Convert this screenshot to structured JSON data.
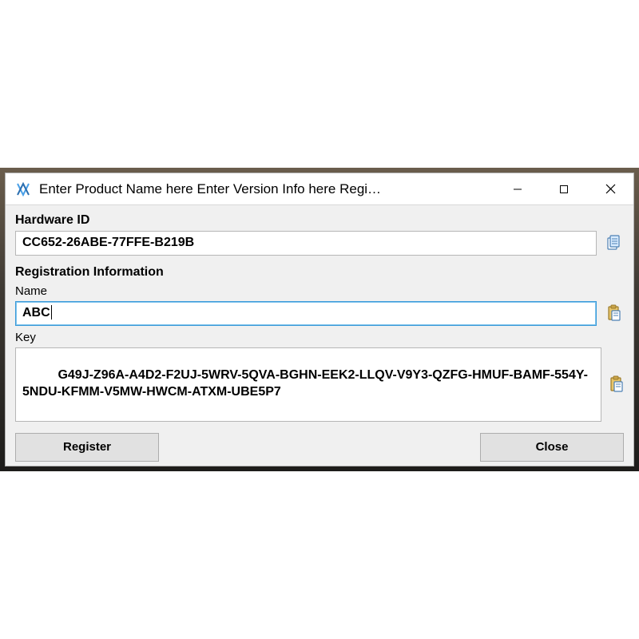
{
  "window": {
    "title": "Enter Product Name here Enter Version Info here Regi…"
  },
  "hardware": {
    "label": "Hardware ID",
    "value": "CC652-26ABE-77FFE-B219B"
  },
  "registration": {
    "label": "Registration Information",
    "name_label": "Name",
    "name_value": "ABC",
    "key_label": "Key",
    "key_value": "G49J-Z96A-A4D2-F2UJ-5WRV-5QVA-BGHN-EEK2-LLQV-V9Y3-QZFG-HMUF-BAMF-554Y-5NDU-KFMM-V5MW-HWCM-ATXM-UBE5P7"
  },
  "buttons": {
    "register": "Register",
    "close": "Close"
  }
}
